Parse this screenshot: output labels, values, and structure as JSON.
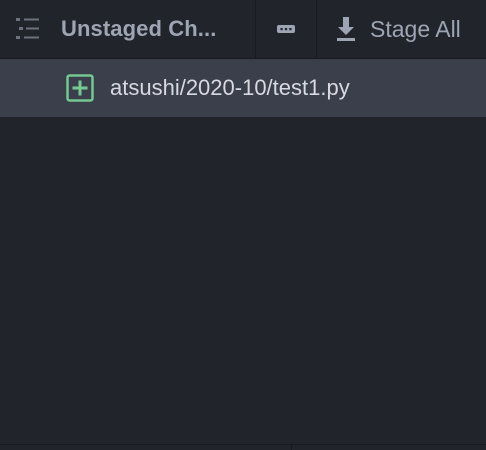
{
  "header": {
    "title": "Unstaged Ch...",
    "stage_all_label": "Stage All"
  },
  "icons": {
    "list": "list-icon",
    "more": "ellipsis-icon",
    "stage": "download-arrow-icon",
    "file_status": "file-added-icon"
  },
  "files": [
    {
      "path": "atsushi/2020-10/test1.py",
      "status": "added"
    }
  ],
  "colors": {
    "background": "#21252b",
    "selected_row": "#3a3f4b",
    "added_status": "#73c990",
    "text_muted": "#9da5b4",
    "text_primary": "#d7dae0"
  }
}
